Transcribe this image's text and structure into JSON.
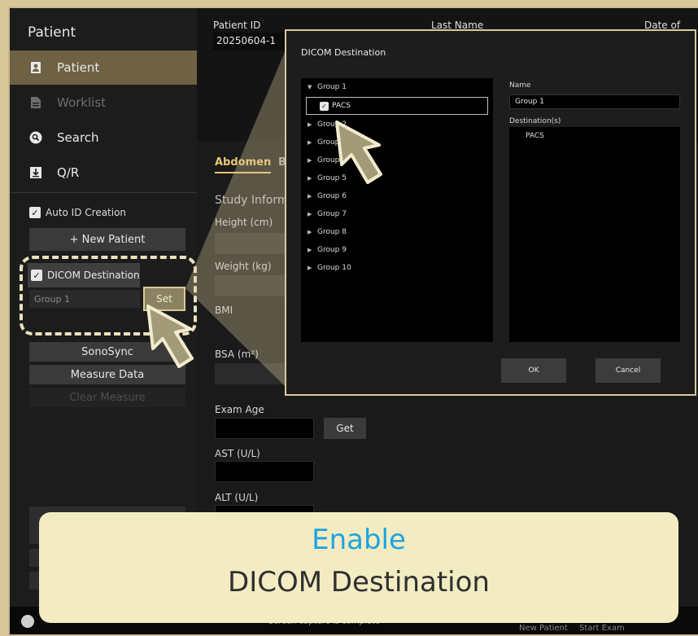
{
  "sidebar": {
    "title": "Patient",
    "nav": [
      {
        "label": "Patient",
        "icon": "patient-icon"
      },
      {
        "label": "Worklist",
        "icon": "worklist-icon"
      },
      {
        "label": "Search",
        "icon": "search-icon"
      },
      {
        "label": "Q/R",
        "icon": "download-icon"
      }
    ],
    "auto_id_label": "Auto ID Creation",
    "new_patient_label": "+ New Patient",
    "dicom_destination_label": "DICOM Destination",
    "group_value": "Group 1",
    "set_label": "Set",
    "sonosync_label": "SonoSync",
    "measure_data_label": "Measure Data",
    "clear_measure_label": "Clear Measure"
  },
  "header": {
    "patient_id_label": "Patient ID",
    "patient_id_value": "20250604-1",
    "last_name_label": "Last Name",
    "dob_label": "Date of Birth"
  },
  "exam": {
    "tabs": [
      "Abdomen",
      "Br"
    ],
    "study_heading": "Study Informa",
    "height_label": "Height (cm)",
    "weight_label": "Weight (kg)",
    "bmi_label": "BMI",
    "bsa_label": "BSA (m²)",
    "exam_age_label": "Exam Age",
    "get_label": "Get",
    "ast_label": "AST (U/L)",
    "alt_label": "ALT (U/L)"
  },
  "dialog": {
    "title": "DICOM Destination",
    "tree": [
      {
        "label": "Group 1",
        "expanded": true
      },
      {
        "label": "Group 2"
      },
      {
        "label": "Group 3"
      },
      {
        "label": "Group 4"
      },
      {
        "label": "Group 5"
      },
      {
        "label": "Group 6"
      },
      {
        "label": "Group 7"
      },
      {
        "label": "Group 8"
      },
      {
        "label": "Group 9"
      },
      {
        "label": "Group 10"
      }
    ],
    "pacs_label": "PACS",
    "name_label": "Name",
    "name_value": "Group 1",
    "destinations_label": "Destination(s)",
    "destinations": [
      "PACS"
    ],
    "ok_label": "OK",
    "cancel_label": "Cancel"
  },
  "bottom_bar": {
    "status_text": "Screen capture is complete",
    "new_patient": "New Patient",
    "start_exam": "Start Exam"
  },
  "callout": {
    "line1": "Enable",
    "line2": "DICOM Destination"
  },
  "colors": {
    "accent_gold": "#e9c776",
    "highlight_beige": "#d9c99c",
    "callout_blue": "#1ea4e0",
    "active_nav": "#6e6144"
  }
}
